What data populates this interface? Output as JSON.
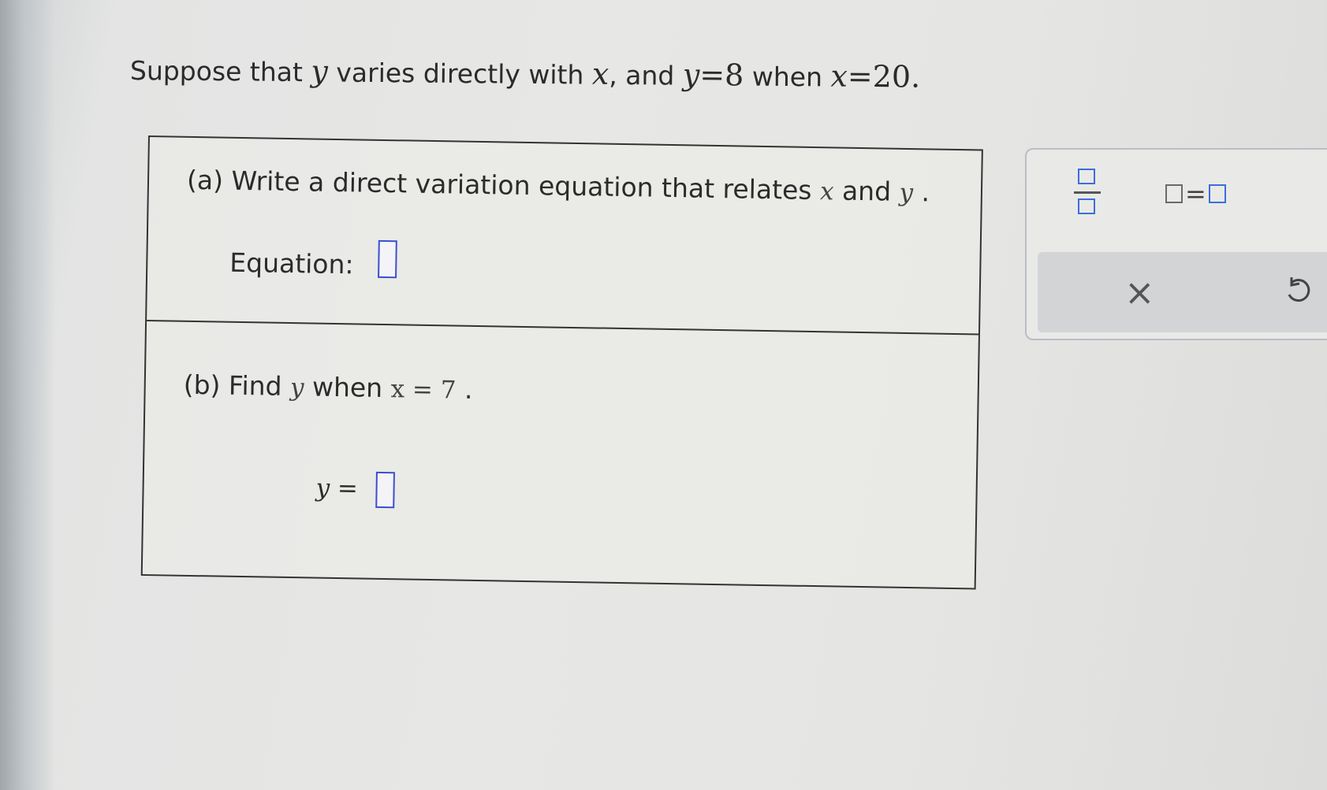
{
  "problem": {
    "intro": "Suppose that ",
    "var_y": "y",
    "mid1": " varies directly with ",
    "var_x": "x",
    "mid2": ", and ",
    "cond_y": "y",
    "eq1": "=8",
    "when": " when ",
    "cond_x": "x",
    "eq2": "=20."
  },
  "part_a": {
    "prompt": "(a) Write a direct variation equation that relates ",
    "var_x": "x",
    "and": " and ",
    "var_y": "y",
    "end": " .",
    "equation_label": "Equation:",
    "answer_value": ""
  },
  "part_b": {
    "prompt": "(b) Find ",
    "var_y": "y",
    "when": " when ",
    "given": "x = 7",
    "end": " .",
    "answer_prefix": "y =",
    "answer_value": ""
  },
  "toolbar": {
    "fraction_icon": "fraction-icon",
    "equation_icon": "equals-template-icon",
    "equals_symbol": "=",
    "clear_symbol": "×",
    "undo_icon": "undo-icon"
  },
  "colors": {
    "answer_box_border": "#3b4fd0",
    "template_square": "#3b6fd6",
    "tool_row_bg": "#d2d4d6"
  }
}
